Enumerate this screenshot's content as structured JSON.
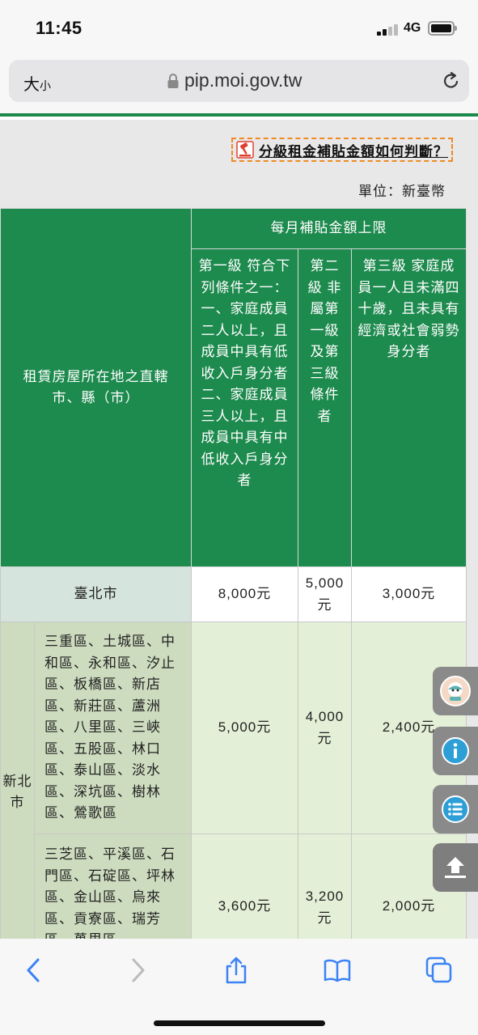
{
  "status": {
    "time": "11:45",
    "network": "4G"
  },
  "browser": {
    "text_size_main": "大",
    "text_size_small": "小",
    "url": "pip.moi.gov.tw"
  },
  "page": {
    "help_link": "分級租金補貼金額如何判斷？",
    "unit": "單位：新臺幣",
    "table": {
      "header_location": "租賃房屋所在地之直轄市、縣（市）",
      "header_monthly": "每月補貼金額上限",
      "level1": "第一級 符合下列條件之一： 一、家庭成員二人以上，且成員中具有低收入戶身分者 二、家庭成員三人以上，且成員中具有中低收入戶身分者",
      "level2": "第二級 非屬第一級及第三級條件者",
      "level3": "第三級 家庭成員一人且未滿四十歲，且未具有經濟或社會弱勢身分者",
      "rows": [
        {
          "city": "臺北市",
          "l1": "8,000元",
          "l2": "5,000元",
          "l3": "3,000元"
        }
      ],
      "ntp_label": "新北市",
      "ntp_rows": [
        {
          "districts": "三重區、土城區、中和區、永和區、汐止區、板橋區、新店區、新莊區、蘆洲區、八里區、三峽區、五股區、林口區、泰山區、淡水區、深坑區、樹林區、鶯歌區",
          "l1": "5,000元",
          "l2": "4,000元",
          "l3": "2,400元"
        },
        {
          "districts": "三芝區、平溪區、石門區、石碇區、坪林區、金山區、烏來區、貢寮區、瑞芳區、萬里區",
          "l1": "3,600元",
          "l2": "3,200元",
          "l3": "2,000元"
        }
      ]
    }
  }
}
